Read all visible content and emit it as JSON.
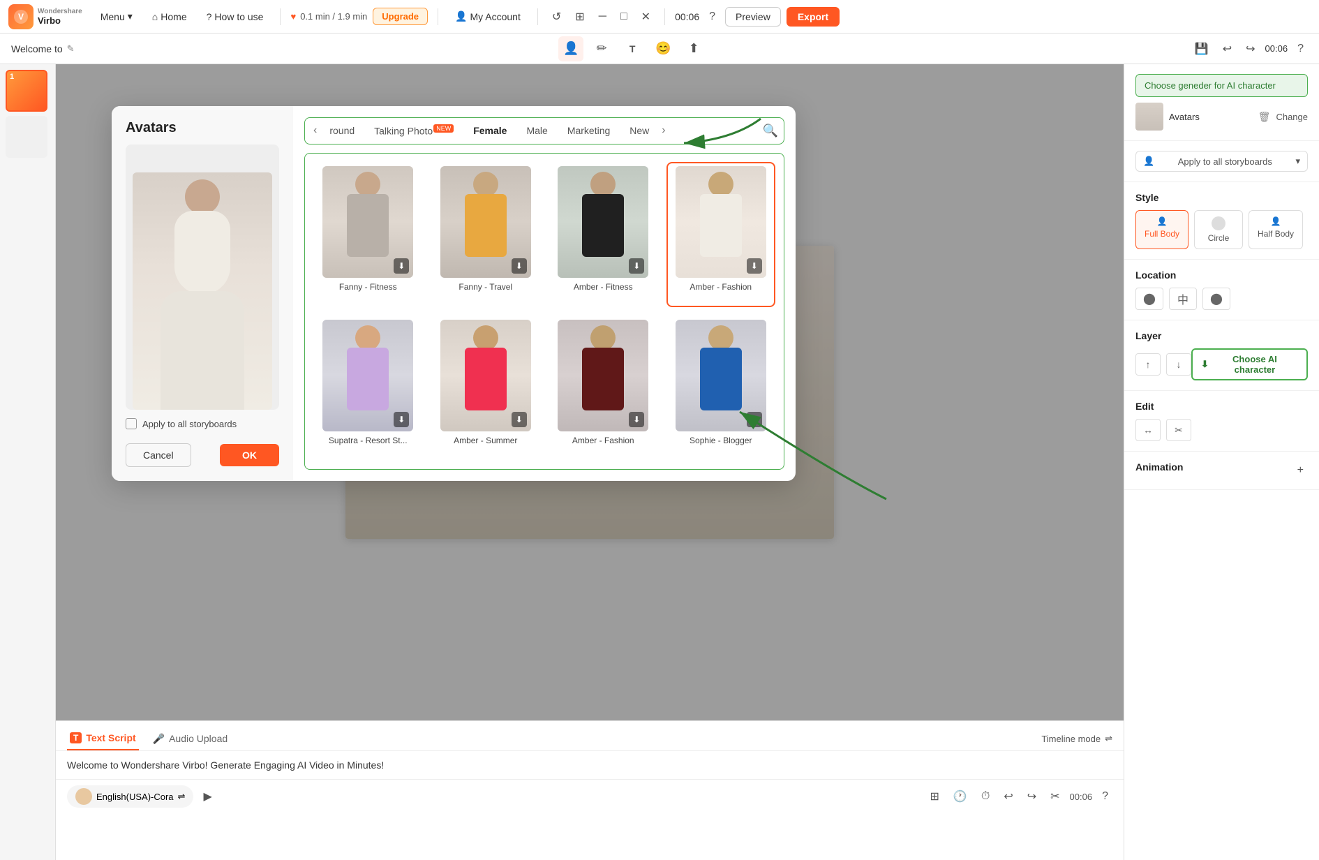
{
  "app": {
    "name": "Virbo",
    "brand": "Wondershare",
    "logo_letters": "V"
  },
  "topbar": {
    "menu_label": "Menu",
    "home_label": "Home",
    "how_to_use_label": "How to use",
    "timer_text": "0.1 min / 1.9 min",
    "upgrade_label": "Upgrade",
    "my_account_label": "My Account",
    "preview_label": "Preview",
    "export_label": "Export",
    "time_display": "00:06"
  },
  "toolbar2": {
    "welcome_text": "Welcome to",
    "time": "00:06"
  },
  "modal": {
    "title": "Avatars",
    "categories": [
      {
        "id": "round",
        "label": "round"
      },
      {
        "id": "talking_photo",
        "label": "Talking Photo",
        "badge": "NEW"
      },
      {
        "id": "female",
        "label": "Female",
        "active": true
      },
      {
        "id": "male",
        "label": "Male"
      },
      {
        "id": "marketing",
        "label": "Marketing"
      },
      {
        "id": "new",
        "label": "New"
      }
    ],
    "avatars_row1": [
      {
        "id": "fanny_fitness",
        "label": "Fanny - Fitness",
        "selected": false
      },
      {
        "id": "fanny_travel",
        "label": "Fanny - Travel",
        "selected": false
      },
      {
        "id": "amber_fitness",
        "label": "Amber - Fitness",
        "selected": false
      },
      {
        "id": "amber_fashion1",
        "label": "Amber - Fashion",
        "selected": true
      }
    ],
    "avatars_row2": [
      {
        "id": "supatra_resort",
        "label": "Supatra - Resort St...",
        "selected": false
      },
      {
        "id": "amber_summer",
        "label": "Amber - Summer",
        "selected": false
      },
      {
        "id": "amber_fashion2",
        "label": "Amber - Fashion",
        "selected": false
      },
      {
        "id": "sophie_blogger",
        "label": "Sophie - Blogger",
        "selected": false
      }
    ],
    "apply_label": "Apply to all storyboards",
    "cancel_label": "Cancel",
    "ok_label": "OK"
  },
  "right_panel": {
    "choose_gender_hint": "Choose geneder for AI character",
    "avatars_label": "Avatars",
    "change_label": "Change",
    "apply_label": "Apply to all storyboards",
    "style_title": "Style",
    "styles": [
      {
        "id": "full_body",
        "label": "Full Body",
        "active": true
      },
      {
        "id": "circle",
        "label": "Circle",
        "active": false
      },
      {
        "id": "half_body",
        "label": "Half Body",
        "active": false
      }
    ],
    "location_title": "Location",
    "layer_title": "Layer",
    "choose_ai_btn": "Choose AI character",
    "edit_title": "Edit",
    "animation_title": "Animation"
  },
  "script_area": {
    "text_script_label": "Text Script",
    "audio_upload_label": "Audio Upload",
    "timeline_label": "Timeline mode",
    "script_text": "Welcome to Wondershare Virbo! Generate Engaging AI Video in Minutes!",
    "voice_label": "English(USA)-Cora"
  },
  "annotations": {
    "choose_gender": "Choose geneder for AI character",
    "choose_ai": "Choose AI character"
  }
}
